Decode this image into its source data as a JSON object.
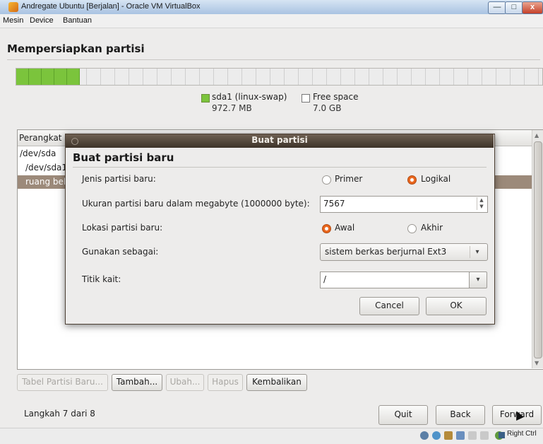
{
  "window": {
    "title": "Andregate Ubuntu [Berjalan] - Oracle VM VirtualBox",
    "minimize_label": "—",
    "maximize_label": "□",
    "close_label": "x"
  },
  "menu": {
    "items": [
      {
        "label": "Mesin"
      },
      {
        "label": "Device"
      },
      {
        "label": "Bantuan"
      }
    ]
  },
  "installer": {
    "page_title": "Mempersiapkan partisi",
    "partition_bar": {
      "used_fraction": 0.12
    },
    "legend": [
      {
        "label": "sda1 (linux-swap)",
        "size": "972.7 MB",
        "color": "#7bc43c"
      },
      {
        "label": "Free space",
        "size": "7.0 GB",
        "color": "#ffffff"
      }
    ],
    "table": {
      "header": "Perangkat",
      "rows": [
        {
          "label": "/dev/sda"
        },
        {
          "label": "/dev/sda1"
        },
        {
          "label": "ruang bel"
        }
      ]
    },
    "actions": [
      {
        "label": "Tabel Partisi Baru...",
        "enabled": false
      },
      {
        "label": "Tambah...",
        "enabled": true
      },
      {
        "label": "Ubah...",
        "enabled": false
      },
      {
        "label": "Hapus",
        "enabled": false
      },
      {
        "label": "Kembalikan",
        "enabled": true
      }
    ],
    "step": "Langkah 7 dari 8",
    "nav": {
      "quit": "Quit",
      "back": "Back",
      "forward": "Forward"
    }
  },
  "dialog": {
    "title": "Buat partisi",
    "heading": "Buat partisi baru",
    "type_label": "Jenis partisi baru:",
    "type_options": [
      {
        "label": "Primer",
        "selected": false
      },
      {
        "label": "Logikal",
        "selected": true
      }
    ],
    "size_label": "Ukuran partisi baru dalam megabyte (1000000 byte):",
    "size_value": "7567",
    "location_label": "Lokasi partisi baru:",
    "location_options": [
      {
        "label": "Awal",
        "selected": true
      },
      {
        "label": "Akhir",
        "selected": false
      }
    ],
    "use_as_label": "Gunakan sebagai:",
    "use_as_value": "sistem berkas berjurnal Ext3",
    "mount_label": "Titik kait:",
    "mount_value": "/",
    "cancel": "Cancel",
    "ok": "OK"
  },
  "statusbar": {
    "host_key": "Right Ctrl"
  }
}
